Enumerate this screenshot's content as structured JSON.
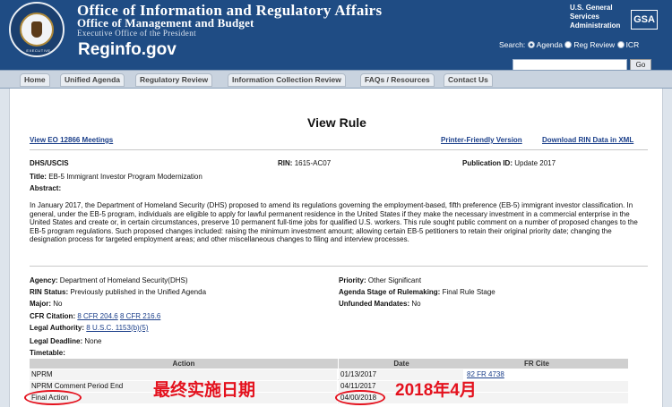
{
  "header": {
    "agency_line1": "Office of Information and Regulatory Affairs",
    "agency_line2": "Office of Management and Budget",
    "agency_line3": "Executive Office of the President",
    "site_name": "Reginfo.gov",
    "gsa_text": [
      "U.S. General",
      "Services",
      "Administration"
    ],
    "gsa_logo": "GSA",
    "seal_text": "EXECUTIVE"
  },
  "search": {
    "label": "Search:",
    "options": [
      "Agenda",
      "Reg Review",
      "ICR"
    ],
    "selected": "Agenda",
    "input_value": "",
    "go_label": "Go"
  },
  "nav": {
    "items": [
      "Home",
      "Unified Agenda",
      "Regulatory Review",
      "Information Collection Review",
      "FAQs / Resources",
      "Contact Us"
    ]
  },
  "page": {
    "title": "View Rule",
    "view_eo_link": "View EO 12866 Meetings",
    "printer_link": "Printer-Friendly Version",
    "download_link": "Download RIN Data in XML"
  },
  "rule": {
    "agency_code": "DHS/USCIS",
    "rin_label": "RIN:",
    "rin_value": "1615-AC07",
    "pub_label": "Publication ID:",
    "pub_value": "Update 2017",
    "title_label": "Title:",
    "title_value": "EB-5 Immigrant Investor Program Modernization",
    "abstract_label": "Abstract:",
    "abstract_text": "In January 2017, the Department of Homeland Security (DHS) proposed to amend its regulations governing the employment-based, fifth preference (EB-5) immigrant investor classification.  In general, under the EB-5 program, individuals are eligible to apply for lawful permanent residence in the United States if they make the necessary investment in a commercial enterprise in the United States and create or, in certain circumstances, preserve 10 permanent full-time jobs for qualified U.S. workers. This rule sought public comment on a number of proposed changes to the EB-5 program regulations. Such proposed changes included: raising the minimum investment amount; allowing certain EB-5 petitioners to retain their original priority date; changing the designation process for targeted employment areas; and other miscellaneous changes to filing and interview processes."
  },
  "details": {
    "agency_label": "Agency:",
    "agency_value": "Department of Homeland Security(DHS)",
    "priority_label": "Priority:",
    "priority_value": "Other Significant",
    "rin_status_label": "RIN Status:",
    "rin_status_value": "Previously published in the Unified Agenda",
    "stage_label": "Agenda Stage of Rulemaking:",
    "stage_value": "Final Rule Stage",
    "major_label": "Major:",
    "major_value": "No",
    "unfunded_label": "Unfunded Mandates:",
    "unfunded_value": "No",
    "cfr_label": "CFR Citation:",
    "cfr_links": [
      "8 CFR 204.6",
      "8 CFR 216.6"
    ],
    "authority_label": "Legal Authority:",
    "authority_link": "8 U.S.C. 1153(b)(5)",
    "deadline_label": "Legal Deadline:",
    "deadline_value": "None",
    "timetable_label": "Timetable:"
  },
  "timetable": {
    "headers": [
      "Action",
      "Date",
      "FR Cite"
    ],
    "rows": [
      {
        "action": "NPRM",
        "date": "01/13/2017",
        "cite": "82 FR 4738"
      },
      {
        "action": "NPRM Comment Period End",
        "date": "04/11/2017",
        "cite": ""
      },
      {
        "action": "Final Action",
        "date": "04/00/2018",
        "cite": ""
      }
    ]
  },
  "annotations": {
    "label_cn": "最终实施日期",
    "date_cn": "2018年4月",
    "color": "#e4121e"
  }
}
